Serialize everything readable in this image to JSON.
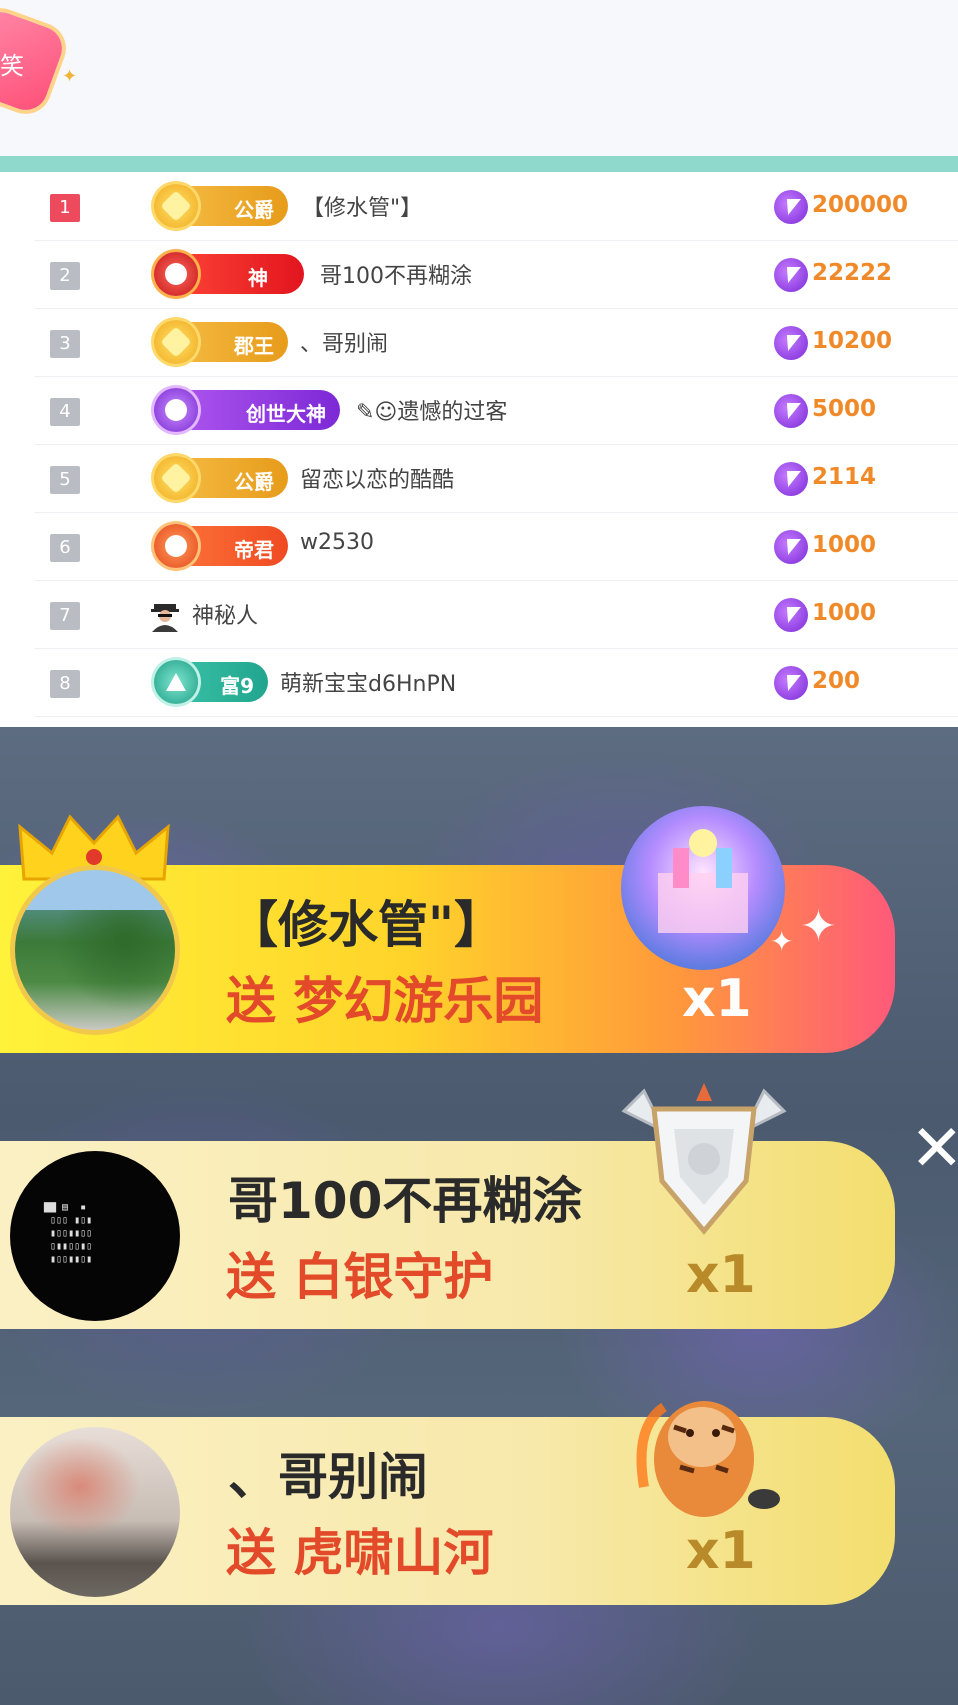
{
  "header": {
    "badge_text": "笑"
  },
  "ranking": [
    {
      "rank": "1",
      "level": "公爵",
      "badge_style": "gold",
      "name": "【修水管\"】",
      "amount": "200000"
    },
    {
      "rank": "2",
      "level": "神",
      "badge_style": "red",
      "name": "哥100不再糊涂",
      "amount": "22222"
    },
    {
      "rank": "3",
      "level": "郡王",
      "badge_style": "gold",
      "name": "、哥别闹",
      "amount": "10200"
    },
    {
      "rank": "4",
      "level": "创世大神",
      "badge_style": "purple",
      "name": "✎☺遗憾的过客",
      "amount": "5000"
    },
    {
      "rank": "5",
      "level": "公爵",
      "badge_style": "gold",
      "name": "留恋以恋的酷酷",
      "amount": "2114"
    },
    {
      "rank": "6",
      "level": "帝君",
      "badge_style": "orange",
      "name": "w2530",
      "amount": "1000"
    },
    {
      "rank": "7",
      "level": "",
      "badge_style": "mystery",
      "name": "神秘人",
      "amount": "1000"
    },
    {
      "rank": "8",
      "level": "富9",
      "badge_style": "teal",
      "name": "萌新宝宝d6HnPN",
      "amount": "200"
    }
  ],
  "gifts": [
    {
      "sender": "【修水管\"】",
      "gift_text": "送 梦幻游乐园",
      "count": "x1"
    },
    {
      "sender": "哥100不再糊涂",
      "gift_text": "送 白银守护",
      "count": "x1"
    },
    {
      "sender": "、哥别闹",
      "gift_text": "送 虎啸山河",
      "count": "x1"
    }
  ],
  "colors": {
    "accent_teal": "#8fd8cc",
    "amount_orange": "#f08a28",
    "gift_red": "#e24a2a"
  },
  "icons": {
    "coin": "lightning-coin-icon",
    "close": "close-icon",
    "mystery_user": "spy-icon",
    "crown": "crown-icon"
  },
  "close_label": "✕"
}
